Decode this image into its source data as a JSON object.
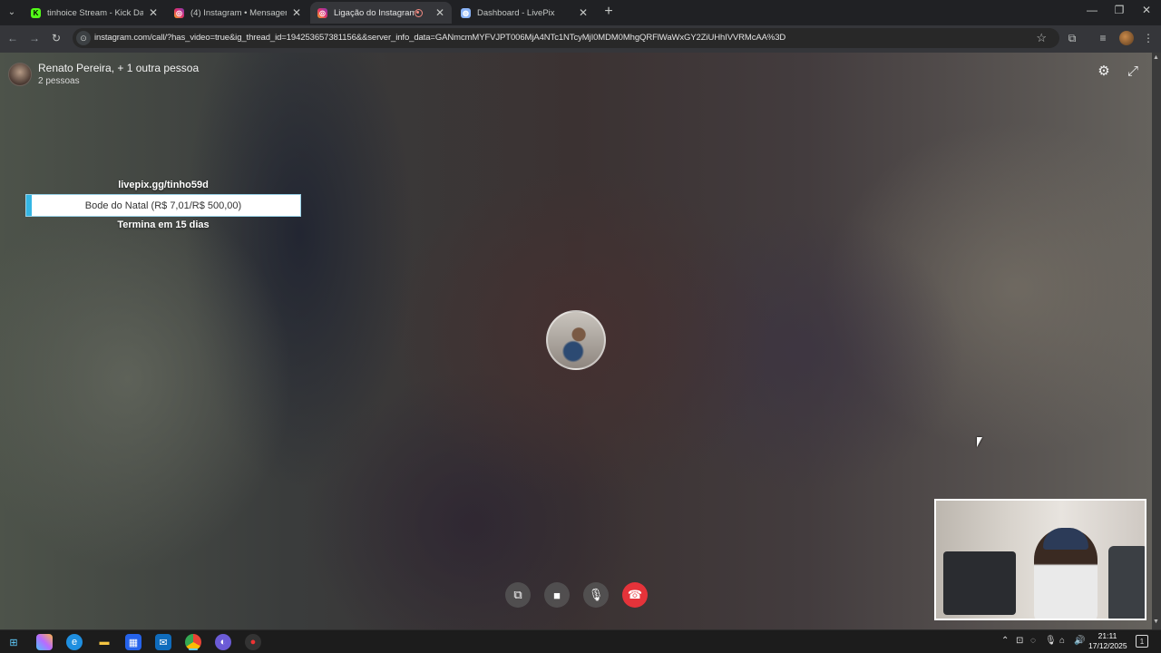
{
  "browser": {
    "tabs": [
      {
        "label": "tinhoice Stream - Kick Dashbo",
        "favicon": "kick-icon",
        "color": "#53fc18"
      },
      {
        "label": "(4) Instagram • Mensagens",
        "favicon": "instagram-icon",
        "color": "#e1306c"
      },
      {
        "label": "Ligação do Instagram",
        "favicon": "instagram-icon",
        "color": "#e1306c"
      },
      {
        "label": "Dashboard - LivePix",
        "favicon": "globe-icon",
        "color": "#8ab4f8"
      }
    ],
    "url": "instagram.com/call/?has_video=true&ig_thread_id=194253657381156&&server_info_data=GANmcmMYFVJPT006MjA4NTc1NTcyMjI0MDM0MhgQRFlWaWxGY2ZiUHhIVVRMcAA%3D"
  },
  "call": {
    "participants_title": "Renato Pereira, + 1 outra pessoa",
    "participants_count": "2 pessoas"
  },
  "livepix": {
    "link": "livepix.gg/tinho59d",
    "goal_text": "Bode do Natal (R$ 7,01/R$ 500,00)",
    "goal_progress": 0.014,
    "ends": "Termina em 15 dias"
  },
  "taskbar": {
    "time": "21:11",
    "date": "17/12/2025"
  }
}
